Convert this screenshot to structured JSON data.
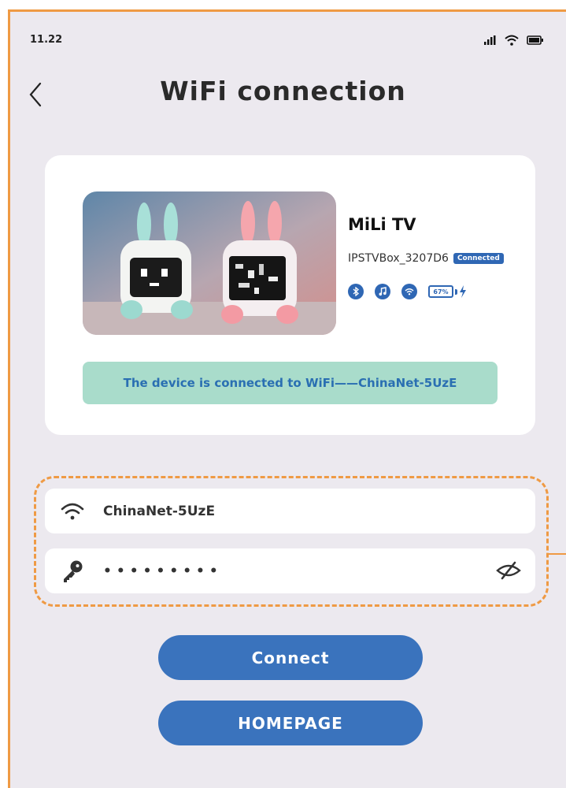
{
  "status": {
    "time": "11.22"
  },
  "header": {
    "title": "WiFi connection"
  },
  "device": {
    "name": "MiLi TV",
    "id": "IPSTVBox_3207D6",
    "status_badge": "Connected",
    "battery": "67%",
    "notice": "The device is connected to WiFi——ChinaNet-5UzE"
  },
  "form": {
    "ssid_value": "ChinaNet-5UzE",
    "password_value": "•••••••••"
  },
  "buttons": {
    "connect": "Connect",
    "homepage": "HOMEPAGE"
  },
  "colors": {
    "accent": "#3a73bd",
    "frame": "#ef9a44",
    "notice_bg": "#a9dccb"
  }
}
